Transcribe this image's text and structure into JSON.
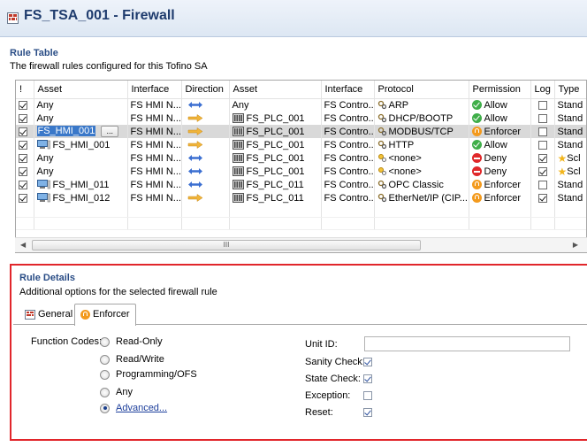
{
  "header": {
    "title": "FS_TSA_001 - Firewall"
  },
  "rule_table": {
    "title": "Rule Table",
    "description": "The firewall rules configured for this Tofino SA",
    "columns": [
      "!",
      "Asset",
      "Interface",
      "Direction",
      "Asset",
      "Interface",
      "Protocol",
      "Permission",
      "Log",
      "Type"
    ],
    "rows": [
      {
        "enabled": true,
        "src_asset": "Any",
        "src_icon": "none",
        "src_iface": "FS HMI N...",
        "direction": "bidirectional",
        "dst_asset": "Any",
        "dst_icon": "none",
        "dst_iface": "FS Contro...",
        "protocol": "ARP",
        "permission": "Allow",
        "perm_icon": "allow",
        "log": false,
        "type": "Stand",
        "type_icon": "none"
      },
      {
        "enabled": true,
        "src_asset": "Any",
        "src_icon": "none",
        "src_iface": "FS HMI N...",
        "direction": "right",
        "dst_asset": "FS_PLC_001",
        "dst_icon": "plc",
        "dst_iface": "FS Contro...",
        "protocol": "DHCP/BOOTP",
        "permission": "Allow",
        "perm_icon": "allow",
        "log": false,
        "type": "Stand",
        "type_icon": "none"
      },
      {
        "enabled": true,
        "src_asset": "FS_HMI_001",
        "src_icon": "none",
        "src_iface": "FS HMI N...",
        "direction": "right",
        "dst_asset": "FS_PLC_001",
        "dst_icon": "plc",
        "dst_iface": "FS Contro...",
        "protocol": "MODBUS/TCP",
        "permission": "Enforcer",
        "perm_icon": "enforcer",
        "log": false,
        "type": "Stand",
        "type_icon": "none",
        "selected": true,
        "ellipsis": "..."
      },
      {
        "enabled": true,
        "src_asset": "FS_HMI_001",
        "src_icon": "pc",
        "src_iface": "FS HMI N...",
        "direction": "right",
        "dst_asset": "FS_PLC_001",
        "dst_icon": "plc",
        "dst_iface": "FS Contro...",
        "protocol": "HTTP",
        "permission": "Allow",
        "perm_icon": "allow",
        "log": false,
        "type": "Stand",
        "type_icon": "none"
      },
      {
        "enabled": true,
        "src_asset": "Any",
        "src_icon": "none",
        "src_iface": "FS HMI N...",
        "direction": "bidirectional",
        "dst_asset": "FS_PLC_001",
        "dst_icon": "plc",
        "dst_iface": "FS Contro...",
        "protocol": "<none>",
        "permission": "Deny",
        "perm_icon": "deny",
        "log": true,
        "type": "Scl",
        "type_icon": "star"
      },
      {
        "enabled": true,
        "src_asset": "Any",
        "src_icon": "none",
        "src_iface": "FS HMI N...",
        "direction": "bidirectional",
        "dst_asset": "FS_PLC_001",
        "dst_icon": "plc",
        "dst_iface": "FS Contro...",
        "protocol": "<none>",
        "permission": "Deny",
        "perm_icon": "deny",
        "log": true,
        "type": "Scl",
        "type_icon": "star"
      },
      {
        "enabled": true,
        "src_asset": "FS_HMI_011",
        "src_icon": "pc",
        "src_iface": "FS HMI N...",
        "direction": "bidirectional",
        "dst_asset": "FS_PLC_011",
        "dst_icon": "plc",
        "dst_iface": "FS Contro...",
        "protocol": "OPC Classic",
        "permission": "Enforcer",
        "perm_icon": "enforcer",
        "log": false,
        "type": "Stand",
        "type_icon": "none"
      },
      {
        "enabled": true,
        "src_asset": "FS_HMI_012",
        "src_icon": "pc",
        "src_iface": "FS HMI N...",
        "direction": "right",
        "dst_asset": "FS_PLC_011",
        "dst_icon": "plc",
        "dst_iface": "FS Contro...",
        "protocol": "EtherNet/IP (CIP...",
        "permission": "Enforcer",
        "perm_icon": "enforcer",
        "log": true,
        "type": "Stand",
        "type_icon": "none"
      }
    ],
    "scrollbar_grip": "III"
  },
  "rule_details": {
    "title": "Rule Details",
    "description": "Additional options for the selected firewall rule",
    "tabs": [
      {
        "label": "General",
        "active": false
      },
      {
        "label": "Enforcer",
        "active": true
      }
    ],
    "function_codes_label": "Function Codes:",
    "function_codes": [
      {
        "label": "Read-Only",
        "selected": false
      },
      {
        "label": "Read/Write",
        "selected": false
      },
      {
        "label": "Programming/OFS",
        "selected": false
      },
      {
        "label": "Any",
        "selected": false
      },
      {
        "label": "Advanced...",
        "selected": true,
        "link": true
      }
    ],
    "unit_id_label": "Unit ID:",
    "unit_id_value": "",
    "checks": [
      {
        "label": "Sanity Check:",
        "checked": true
      },
      {
        "label": "State Check:",
        "checked": true
      },
      {
        "label": "Exception:",
        "checked": false
      },
      {
        "label": "Reset:",
        "checked": true
      }
    ]
  },
  "colors": {
    "title": "#1f3c6e",
    "section_title": "#2a4d86",
    "highlight_border": "#e1262b",
    "selection": "#3a78c9"
  }
}
